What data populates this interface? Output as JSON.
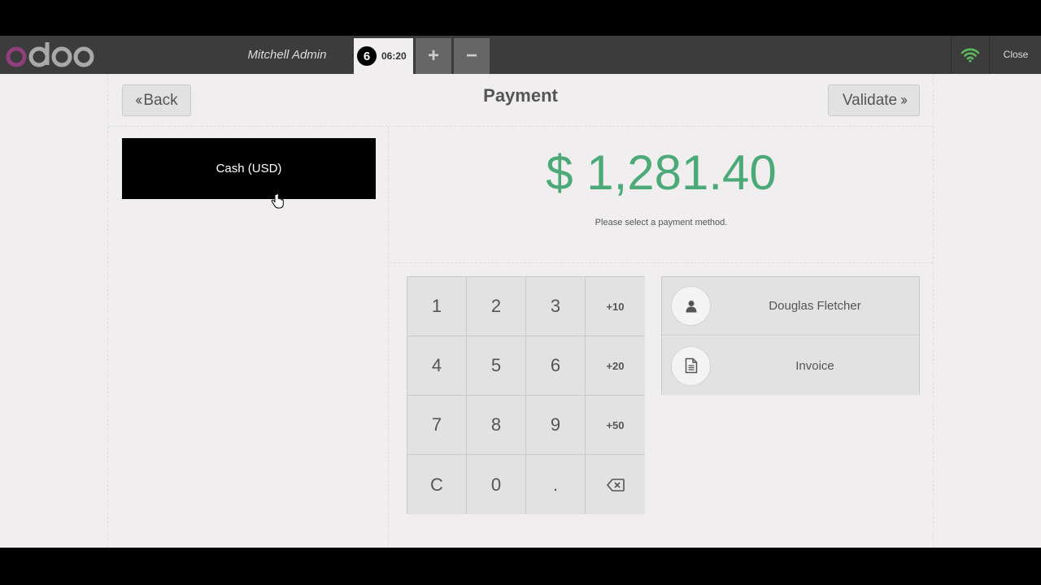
{
  "header": {
    "logo_text": "odoo",
    "cashier": "Mitchell Admin",
    "order": {
      "number": "6",
      "time": "06:20"
    },
    "add_order_label": "+",
    "remove_order_label": "−",
    "close_label": "Close",
    "wifi_icon": "wifi-icon",
    "accent_colors": {
      "logo_purple": "#8f3f7d",
      "wifi_green": "#5cb85c"
    }
  },
  "payment": {
    "back_label": "Back",
    "title": "Payment",
    "validate_label": "Validate",
    "methods": [
      {
        "label": "Cash (USD)"
      }
    ],
    "due_amount": "$ 1,281.40",
    "due_message": "Please select a payment method.",
    "amount_color": "#4caa79"
  },
  "numpad": {
    "keys": [
      "1",
      "2",
      "3",
      "+10",
      "4",
      "5",
      "6",
      "+20",
      "7",
      "8",
      "9",
      "+50",
      "C",
      "0",
      ".",
      "⌫"
    ]
  },
  "side_buttons": {
    "customer": {
      "label": "Douglas Fletcher",
      "icon": "user-icon"
    },
    "invoice": {
      "label": "Invoice",
      "icon": "document-icon"
    }
  }
}
